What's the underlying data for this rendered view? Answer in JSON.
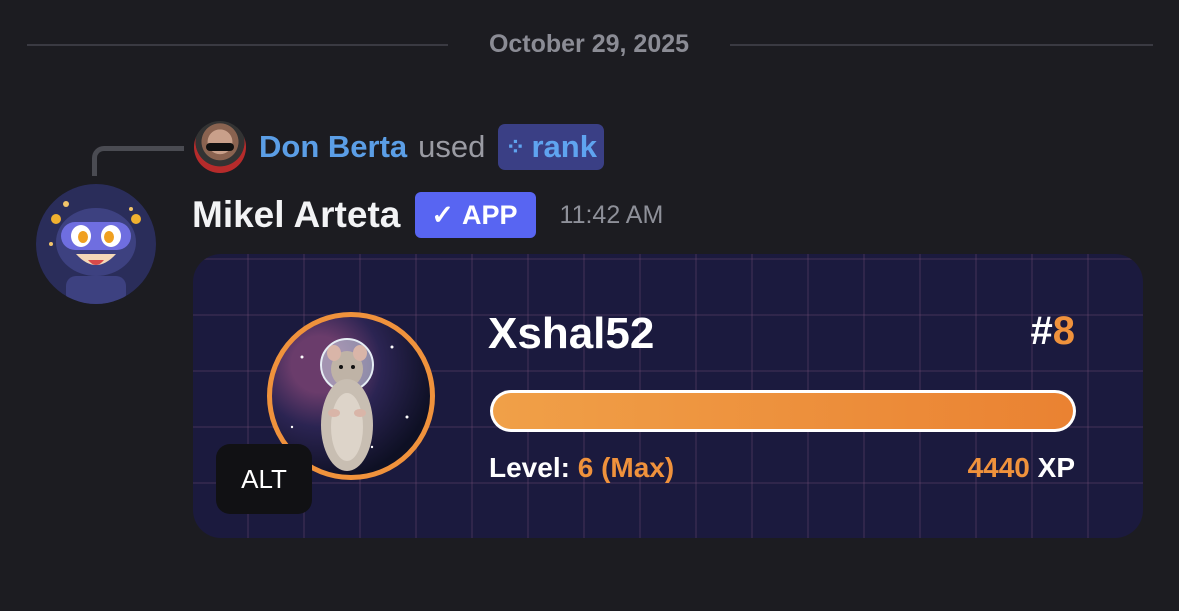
{
  "divider": {
    "date": "October 29, 2025"
  },
  "reply": {
    "user": "Don Berta",
    "used_text": "used",
    "command": "rank",
    "command_icon": "app-command-icon"
  },
  "message": {
    "author": "Mikel Arteta",
    "badge": "APP",
    "badge_icon": "check-icon",
    "timestamp": "11:42 AM"
  },
  "rank_card": {
    "username": "Xshal52",
    "rank_prefix": "#",
    "rank": "8",
    "level_label": "Level:",
    "level_value": "6 (Max)",
    "xp_value": "4440",
    "xp_label": "XP",
    "progress": 1.0,
    "accent_color": "#f0923c",
    "background_color": "#1b1a3e"
  },
  "alt_button": {
    "label": "ALT"
  },
  "colors": {
    "background": "#1c1c21",
    "username_link": "#5b9ee6",
    "app_badge": "#5865f2",
    "command_pill": "#3a3f85"
  }
}
